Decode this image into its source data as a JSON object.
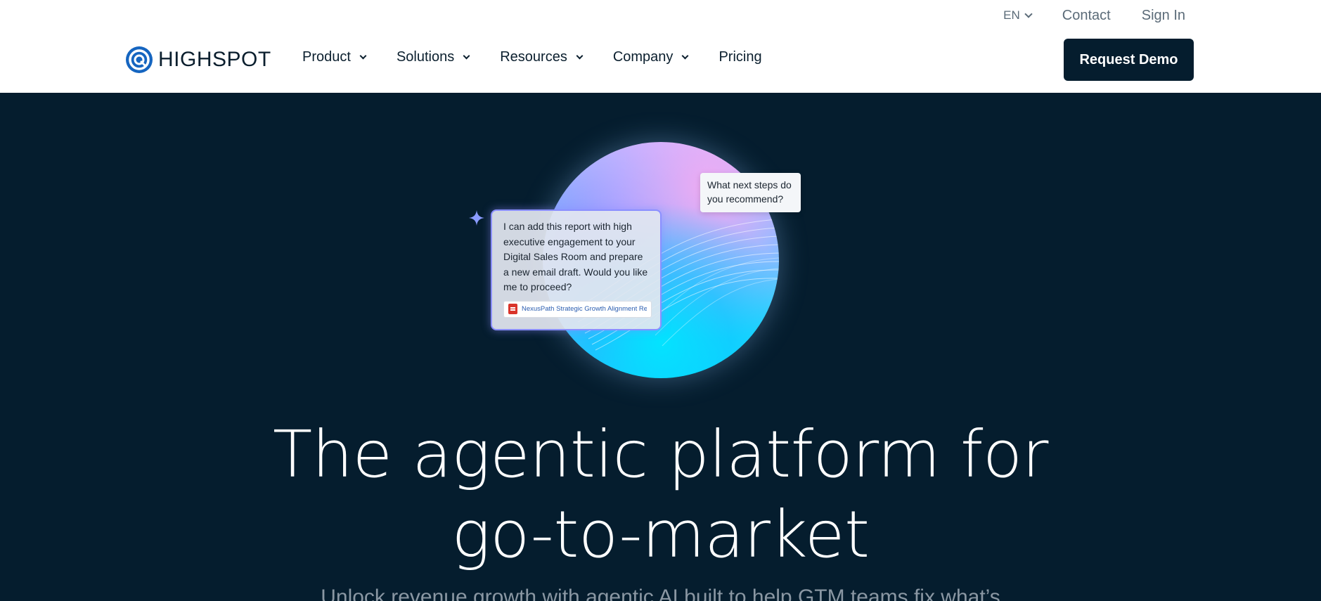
{
  "header": {
    "utility": {
      "language": "EN",
      "contact": "Contact",
      "sign_in": "Sign In"
    },
    "logo_text": "HIGHSPOT",
    "nav": [
      {
        "label": "Product",
        "has_dropdown": true
      },
      {
        "label": "Solutions",
        "has_dropdown": true
      },
      {
        "label": "Resources",
        "has_dropdown": true
      },
      {
        "label": "Company",
        "has_dropdown": true
      },
      {
        "label": "Pricing",
        "has_dropdown": false
      }
    ],
    "cta_label": "Request Demo"
  },
  "hero": {
    "chat_message": "I can add this report with high executive engagement to your Digital Sales Room and prepare a new email draft. Would you like me to proceed?",
    "attachment_name": "NexusPath Strategic Growth Alignment Report",
    "question": "What next steps do you recommend?",
    "headline_line1": "The agentic platform for",
    "headline_line2": "go-to-market",
    "subheadline": "Unlock revenue growth with agentic AI built to help GTM teams fix what’s"
  },
  "colors": {
    "brand": "#1565c0",
    "dark_bg": "#051d2e",
    "cta_bg": "#051d2e",
    "accent_border": "#8b8fff"
  },
  "icons": [
    "highspot-logo-icon",
    "chevron-down-icon",
    "sparkle-icon",
    "pdf-file-icon"
  ]
}
